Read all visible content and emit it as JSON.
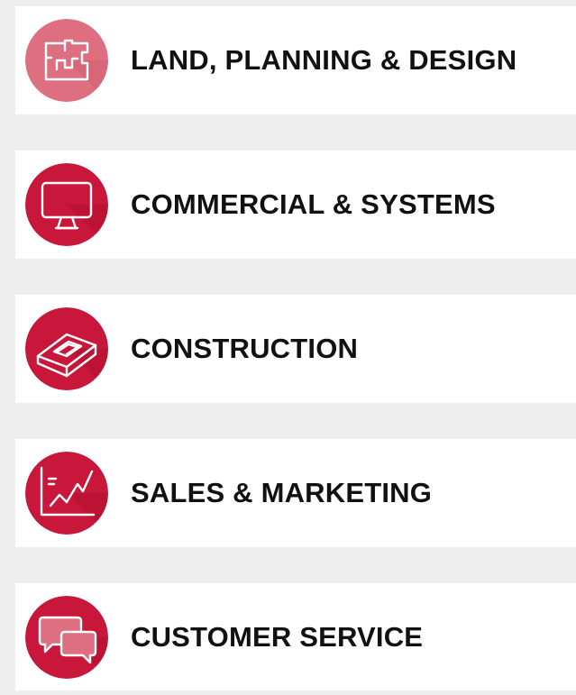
{
  "categories": [
    {
      "label": "LAND, PLANNING & DESIGN",
      "icon": "floor-plan-icon",
      "icon_bg": "#de6f80",
      "state": "selected"
    },
    {
      "label": "COMMERCIAL & SYSTEMS",
      "icon": "monitor-icon",
      "icon_bg": "#c8173a"
    },
    {
      "label": "CONSTRUCTION",
      "icon": "brick-icon",
      "icon_bg": "#c8173a"
    },
    {
      "label": "SALES & MARKETING",
      "icon": "growth-chart-icon",
      "icon_bg": "#c8173a"
    },
    {
      "label": "CUSTOMER SERVICE",
      "icon": "chat-bubbles-icon",
      "icon_bg": "#c8173a"
    }
  ],
  "colors": {
    "page_bg": "#eeeeee",
    "card_bg": "#ffffff",
    "label": "#111111",
    "accent": "#c8173a",
    "accent_light": "#de6f80"
  }
}
